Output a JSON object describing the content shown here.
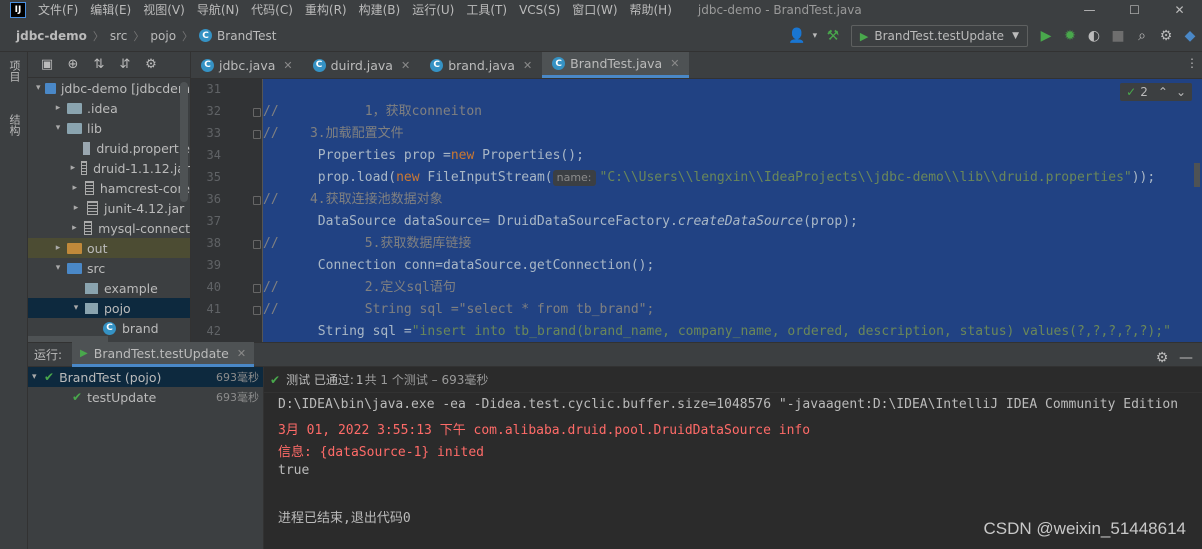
{
  "menubar": {
    "app_logo": "IJ",
    "items": [
      "文件(F)",
      "编辑(E)",
      "视图(V)",
      "导航(N)",
      "代码(C)",
      "重构(R)",
      "构建(B)",
      "运行(U)",
      "工具(T)",
      "VCS(S)",
      "窗口(W)",
      "帮助(H)"
    ],
    "window_title": "jdbc-demo - BrandTest.java",
    "window_controls": [
      "—",
      "☐",
      "✕"
    ]
  },
  "breadcrumb": {
    "project": "jdbc-demo",
    "items": [
      "src",
      "pojo",
      "BrandTest"
    ]
  },
  "toolbar": {
    "run_config": "BrandTest.testUpdate"
  },
  "left_stripe": {
    "tabs": [
      "项目",
      "结构"
    ]
  },
  "project_tree": {
    "rows": [
      {
        "label": "jdbc-demo [jdbcdem",
        "depth": 0,
        "arrow": "▾",
        "icon": "folder-blue",
        "bold": true
      },
      {
        "label": ".idea",
        "depth": 1,
        "arrow": "▸",
        "icon": "folder"
      },
      {
        "label": "lib",
        "depth": 1,
        "arrow": "▾",
        "icon": "folder"
      },
      {
        "label": "druid.propertie",
        "depth": 2,
        "arrow": "",
        "icon": "file"
      },
      {
        "label": "druid-1.1.12.jar",
        "depth": 2,
        "arrow": "▸",
        "icon": "jar"
      },
      {
        "label": "hamcrest-core",
        "depth": 2,
        "arrow": "▸",
        "icon": "jar"
      },
      {
        "label": "junit-4.12.jar",
        "depth": 2,
        "arrow": "▸",
        "icon": "jar"
      },
      {
        "label": "mysql-connect",
        "depth": 2,
        "arrow": "▸",
        "icon": "jar"
      },
      {
        "label": "out",
        "depth": 1,
        "arrow": "▸",
        "icon": "folder-orange",
        "highlight": "out"
      },
      {
        "label": "src",
        "depth": 1,
        "arrow": "▾",
        "icon": "folder-blue"
      },
      {
        "label": "example",
        "depth": 2,
        "arrow": "",
        "icon": "package"
      },
      {
        "label": "pojo",
        "depth": 2,
        "arrow": "▾",
        "icon": "package",
        "highlight": "sel"
      },
      {
        "label": "brand",
        "depth": 3,
        "arrow": "",
        "icon": "class"
      }
    ]
  },
  "tabs": [
    {
      "label": "jdbc.java",
      "active": false
    },
    {
      "label": "duird.java",
      "active": false
    },
    {
      "label": "brand.java",
      "active": false
    },
    {
      "label": "BrandTest.java",
      "active": true
    }
  ],
  "editor": {
    "inspection_count": "2",
    "line_numbers": [
      "31",
      "32",
      "33",
      "34",
      "35",
      "36",
      "37",
      "38",
      "39",
      "40",
      "41",
      "42"
    ],
    "lines": [
      {
        "segments": []
      },
      {
        "segments": [
          {
            "t": "//           1，获取conneiton",
            "c": "cm"
          }
        ]
      },
      {
        "segments": [
          {
            "t": "//    3.加载配置文件",
            "c": "cm"
          }
        ]
      },
      {
        "segments": [
          {
            "t": "       Properties prop =",
            "c": ""
          },
          {
            "t": "new ",
            "c": "kw"
          },
          {
            "t": "Properties();",
            "c": ""
          }
        ]
      },
      {
        "segments": [
          {
            "t": "       prop.load(",
            "c": ""
          },
          {
            "t": "new ",
            "c": "kw"
          },
          {
            "t": "FileInputStream(",
            "c": ""
          },
          {
            "t": "name:",
            "c": "hint"
          },
          {
            "t": "\"C:\\\\Users\\\\lengxin\\\\IdeaProjects\\\\jdbc-demo\\\\lib\\\\druid.properties\"",
            "c": "str"
          },
          {
            "t": "));",
            "c": ""
          }
        ]
      },
      {
        "segments": [
          {
            "t": "//    4.获取连接池数据对象",
            "c": "cm"
          }
        ]
      },
      {
        "segments": [
          {
            "t": "       DataSource dataSource= DruidDataSourceFactory.",
            "c": ""
          },
          {
            "t": "createDataSource",
            "c": "it"
          },
          {
            "t": "(prop);",
            "c": ""
          }
        ]
      },
      {
        "segments": [
          {
            "t": "//           5.获取数据库链接",
            "c": "cm"
          }
        ]
      },
      {
        "segments": [
          {
            "t": "       Connection conn=dataSource.getConnection();",
            "c": ""
          }
        ]
      },
      {
        "segments": [
          {
            "t": "//           2.定义sql语句",
            "c": "cm"
          }
        ]
      },
      {
        "segments": [
          {
            "t": "//           String sql =\"select * from tb_brand\";",
            "c": "cm"
          }
        ]
      },
      {
        "segments": [
          {
            "t": "       String sql =",
            "c": ""
          },
          {
            "t": "\"insert into tb_brand(brand_name, company_name, ordered, description, status) values(?,?,?,?,?);\"",
            "c": "str"
          }
        ]
      }
    ]
  },
  "run_panel": {
    "label": "运行:",
    "tab": "BrandTest.testUpdate",
    "tests": [
      {
        "label": "BrandTest (pojo)",
        "time": "693毫秒",
        "selected": true
      },
      {
        "label": "testUpdate",
        "time": "693毫秒",
        "selected": false
      }
    ],
    "status_prefix": "测试 已通过:",
    "status_count": "1",
    "status_suffix": "共 1 个测试 – 693毫秒",
    "console": [
      {
        "text": "D:\\IDEA\\bin\\java.exe -ea -Didea.test.cyclic.buffer.size=1048576 \"-javaagent:D:\\IDEA\\IntelliJ IDEA Community Edition",
        "err": false
      },
      {
        "text": "3月 01, 2022 3:55:13 下午 com.alibaba.druid.pool.DruidDataSource info",
        "err": true
      },
      {
        "text": "信息: {dataSource-1} inited",
        "err": true
      },
      {
        "text": "true",
        "err": false
      },
      {
        "text": "",
        "err": false
      },
      {
        "text": "进程已结束,退出代码0",
        "err": false
      }
    ]
  },
  "watermark": "CSDN @weixin_51448614",
  "colors": {
    "editor_selection": "#214283",
    "panel_bg": "#3c3f41",
    "console_error": "#ff6b68",
    "success_green": "#49a84c",
    "accent_blue": "#4a88c7"
  }
}
